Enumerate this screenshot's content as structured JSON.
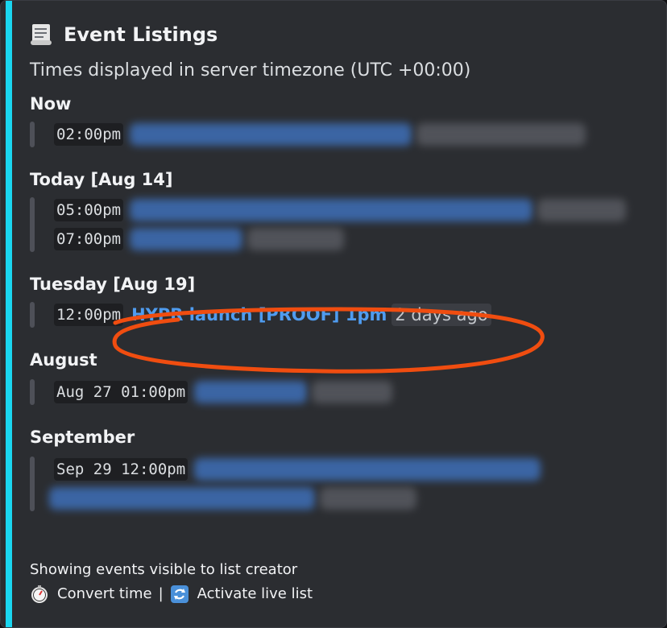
{
  "embed": {
    "title": "Event Listings",
    "description": "Times displayed in server timezone (UTC +00:00)",
    "accent_color": "#1ad6f0"
  },
  "sections": [
    {
      "heading": "Now",
      "events": [
        {
          "time": "02:00pm"
        }
      ]
    },
    {
      "heading": "Today [Aug 14]",
      "events": [
        {
          "time": "05:00pm"
        },
        {
          "time": "07:00pm"
        }
      ]
    },
    {
      "heading": "Tuesday [Aug 19]",
      "events": [
        {
          "time": "12:00pm",
          "name": "HYPR launch [PROOF] 1pm",
          "relative": "2 days ago"
        }
      ]
    },
    {
      "heading": "August",
      "events": [
        {
          "time": "Aug 27 01:00pm"
        }
      ]
    },
    {
      "heading": "September",
      "events": [
        {
          "time": "Sep 29 12:00pm"
        }
      ]
    }
  ],
  "footer": {
    "note": "Showing events visible to list creator",
    "convert_label": "Convert time",
    "separator": "|",
    "live_label": "Activate live list"
  },
  "icons": {
    "title": "scroll-icon",
    "convert": "stopwatch-icon",
    "live": "cycle-icon"
  },
  "annotation_color": "#f04d10"
}
